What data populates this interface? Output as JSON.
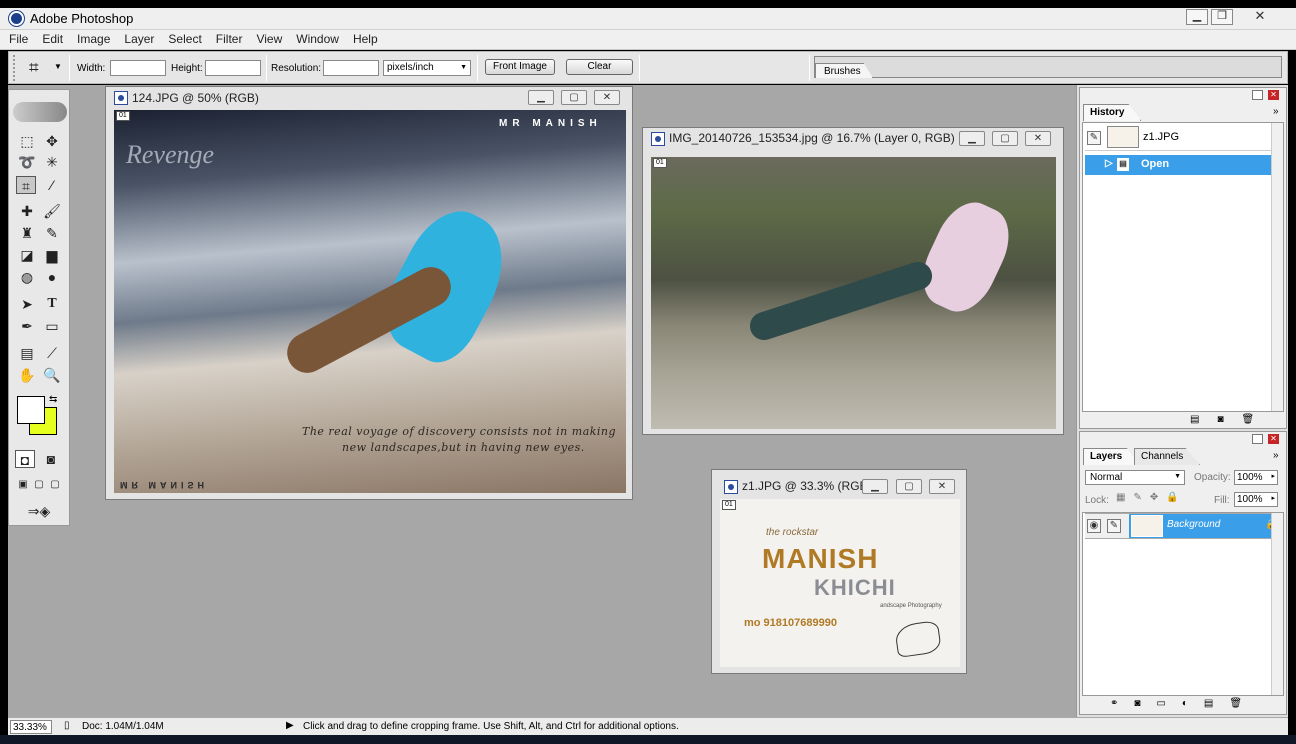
{
  "app": {
    "title": "Adobe Photoshop"
  },
  "menu": [
    "File",
    "Edit",
    "Image",
    "Layer",
    "Select",
    "Filter",
    "View",
    "Window",
    "Help"
  ],
  "options": {
    "width_label": "Width:",
    "width_value": "",
    "height_label": "Height:",
    "height_value": "",
    "resolution_label": "Resolution:",
    "resolution_value": "",
    "units": "pixels/inch",
    "front_image": "Front Image",
    "clear": "Clear"
  },
  "brushes_tab": "Brushes",
  "colors": {
    "foreground": "#ffffff",
    "background": "#e6ff1e",
    "workspace": "#a7a7a7",
    "accent": "#3a9ee8"
  },
  "doc1": {
    "title": "124.JPG @ 50% (RGB)",
    "tag": "01",
    "mr_manish": "MR MANISH",
    "revenge": "Revenge",
    "quote1": "The real voyage of discovery consists not in making",
    "quote2": "new landscapes,but in having new eyes.",
    "mirror": "MR MANISH"
  },
  "doc2": {
    "title": "IMG_20140726_153534.jpg @ 16.7% (Layer 0, RGB)",
    "tag": "01"
  },
  "doc3": {
    "title": "z1.JPG @ 33.3% (RGB)",
    "tag": "01",
    "rockstar": "the rockstar",
    "manish": "MANISH",
    "khichi": "KHICHI",
    "landscape": "andscape Photography",
    "mo": "mo 918107689990"
  },
  "history": {
    "tab": "History",
    "snapshot": "z1.JPG",
    "step": "Open"
  },
  "layers": {
    "tab": "Layers",
    "channels_tab": "Channels",
    "blend": "Normal",
    "opacity_label": "Opacity:",
    "opacity": "100%",
    "lock_label": "Lock:",
    "fill_label": "Fill:",
    "fill": "100%",
    "layer_name": "Background"
  },
  "status": {
    "zoom": "33.33%",
    "doc": "Doc: 1.04M/1.04M",
    "hint": "Click and drag to define cropping frame. Use Shift, Alt, and Ctrl for additional options."
  }
}
